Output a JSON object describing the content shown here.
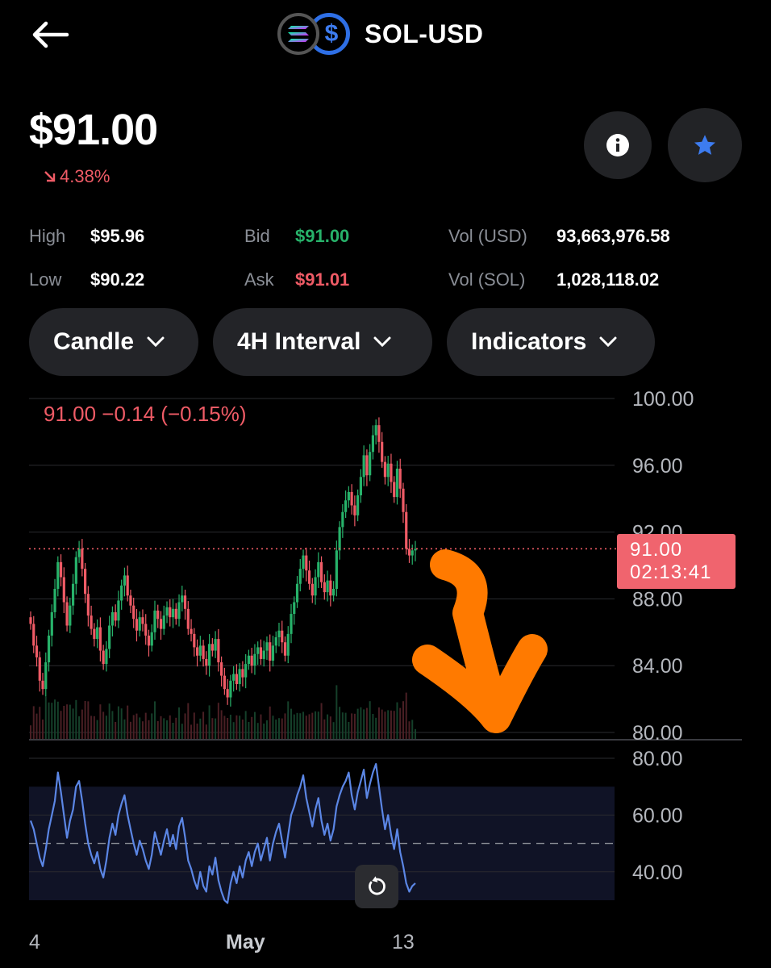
{
  "header": {
    "back_icon": "arrow-left-icon",
    "title": "SOL-USD",
    "coin_icons": [
      "sol-icon",
      "usd-icon"
    ]
  },
  "price": {
    "current": "$91.00",
    "change_pct": "4.38%",
    "change_direction": "down"
  },
  "actions": {
    "info_icon": "info-icon",
    "favorite_icon": "star-icon"
  },
  "stats": {
    "high_label": "High",
    "high_value": "$95.96",
    "low_label": "Low",
    "low_value": "$90.22",
    "bid_label": "Bid",
    "bid_value": "$91.00",
    "ask_label": "Ask",
    "ask_value": "$91.01",
    "vol_usd_label": "Vol (USD)",
    "vol_usd_value": "93,663,976.58",
    "vol_sol_label": "Vol (SOL)",
    "vol_sol_value": "1,028,118.02"
  },
  "controls": {
    "chart_type": "Candle",
    "interval": "4H Interval",
    "indicators": "Indicators"
  },
  "colors": {
    "up": "#27b26a",
    "down": "#ef5b66",
    "rsi": "#5b86e5",
    "accent_blue": "#3d7cf0",
    "annotation": "#ff7a00"
  },
  "chart_data": {
    "type": "candlestick",
    "ohlc_readout": "91.00  −0.14 (−0.15%)",
    "price_axis": {
      "ticks": [
        "100.00",
        "96.00",
        "92.00",
        "88.00",
        "84.00",
        "80.00"
      ],
      "min": 80,
      "max": 100
    },
    "last_price": {
      "value": "91.00",
      "countdown": "02:13:41"
    },
    "rsi_axis": {
      "ticks": [
        "80.00",
        "60.00",
        "40.00"
      ],
      "min": 30,
      "max": 80,
      "band": [
        30,
        70
      ],
      "mid": 50
    },
    "x_labels": [
      "4",
      "May",
      "13"
    ],
    "close": [
      86.5,
      85.2,
      84.5,
      83.1,
      82.6,
      84.2,
      85.8,
      87.2,
      88.6,
      90.2,
      89.3,
      87.8,
      86.4,
      87.6,
      88.9,
      90.5,
      91.0,
      89.8,
      88.3,
      87.0,
      86.2,
      85.6,
      86.3,
      84.9,
      84.1,
      85.0,
      86.4,
      87.2,
      86.7,
      87.9,
      88.8,
      89.4,
      88.2,
      87.6,
      86.8,
      86.1,
      86.9,
      86.5,
      85.8,
      85.2,
      86.0,
      87.3,
      86.8,
      86.2,
      87.0,
      87.5,
      86.9,
      87.4,
      86.8,
      87.8,
      88.2,
      87.4,
      86.2,
      85.9,
      85.1,
      84.6,
      85.2,
      84.4,
      84.0,
      85.3,
      84.9,
      85.6,
      84.2,
      83.4,
      82.6,
      82.1,
      83.1,
      83.5,
      82.9,
      83.8,
      83.3,
      84.1,
      84.6,
      84.0,
      84.7,
      85.1,
      84.4,
      84.9,
      85.4,
      84.3,
      85.2,
      85.7,
      86.1,
      85.4,
      84.6,
      85.9,
      87.1,
      87.8,
      88.9,
      89.8,
      90.6,
      89.7,
      88.9,
      88.2,
      89.3,
      90.2,
      89.0,
      88.4,
      89.1,
      88.2,
      88.6,
      90.9,
      92.3,
      93.2,
      93.9,
      94.4,
      93.6,
      93.0,
      94.2,
      95.3,
      96.6,
      95.4,
      96.8,
      97.8,
      98.4,
      97.4,
      96.2,
      95.3,
      96.1,
      95.0,
      94.1,
      95.8,
      94.6,
      93.2,
      91.0,
      90.6,
      90.9,
      91.0
    ],
    "rsi": [
      58,
      55,
      50,
      45,
      42,
      48,
      55,
      60,
      65,
      75,
      68,
      60,
      52,
      58,
      62,
      70,
      72,
      65,
      57,
      50,
      46,
      43,
      47,
      41,
      38,
      44,
      52,
      57,
      53,
      60,
      64,
      67,
      60,
      55,
      50,
      46,
      51,
      48,
      44,
      41,
      46,
      54,
      50,
      46,
      51,
      55,
      49,
      53,
      48,
      56,
      59,
      52,
      44,
      41,
      37,
      34,
      40,
      35,
      33,
      42,
      39,
      45,
      37,
      33,
      30,
      29,
      36,
      40,
      36,
      42,
      38,
      44,
      47,
      42,
      47,
      50,
      44,
      48,
      52,
      44,
      50,
      54,
      57,
      51,
      45,
      53,
      60,
      63,
      67,
      70,
      74,
      66,
      61,
      56,
      62,
      66,
      58,
      53,
      57,
      51,
      55,
      63,
      67,
      70,
      72,
      75,
      67,
      62,
      68,
      72,
      76,
      66,
      71,
      75,
      78,
      70,
      62,
      55,
      60,
      53,
      48,
      55,
      47,
      42,
      36,
      33,
      35,
      36
    ]
  }
}
